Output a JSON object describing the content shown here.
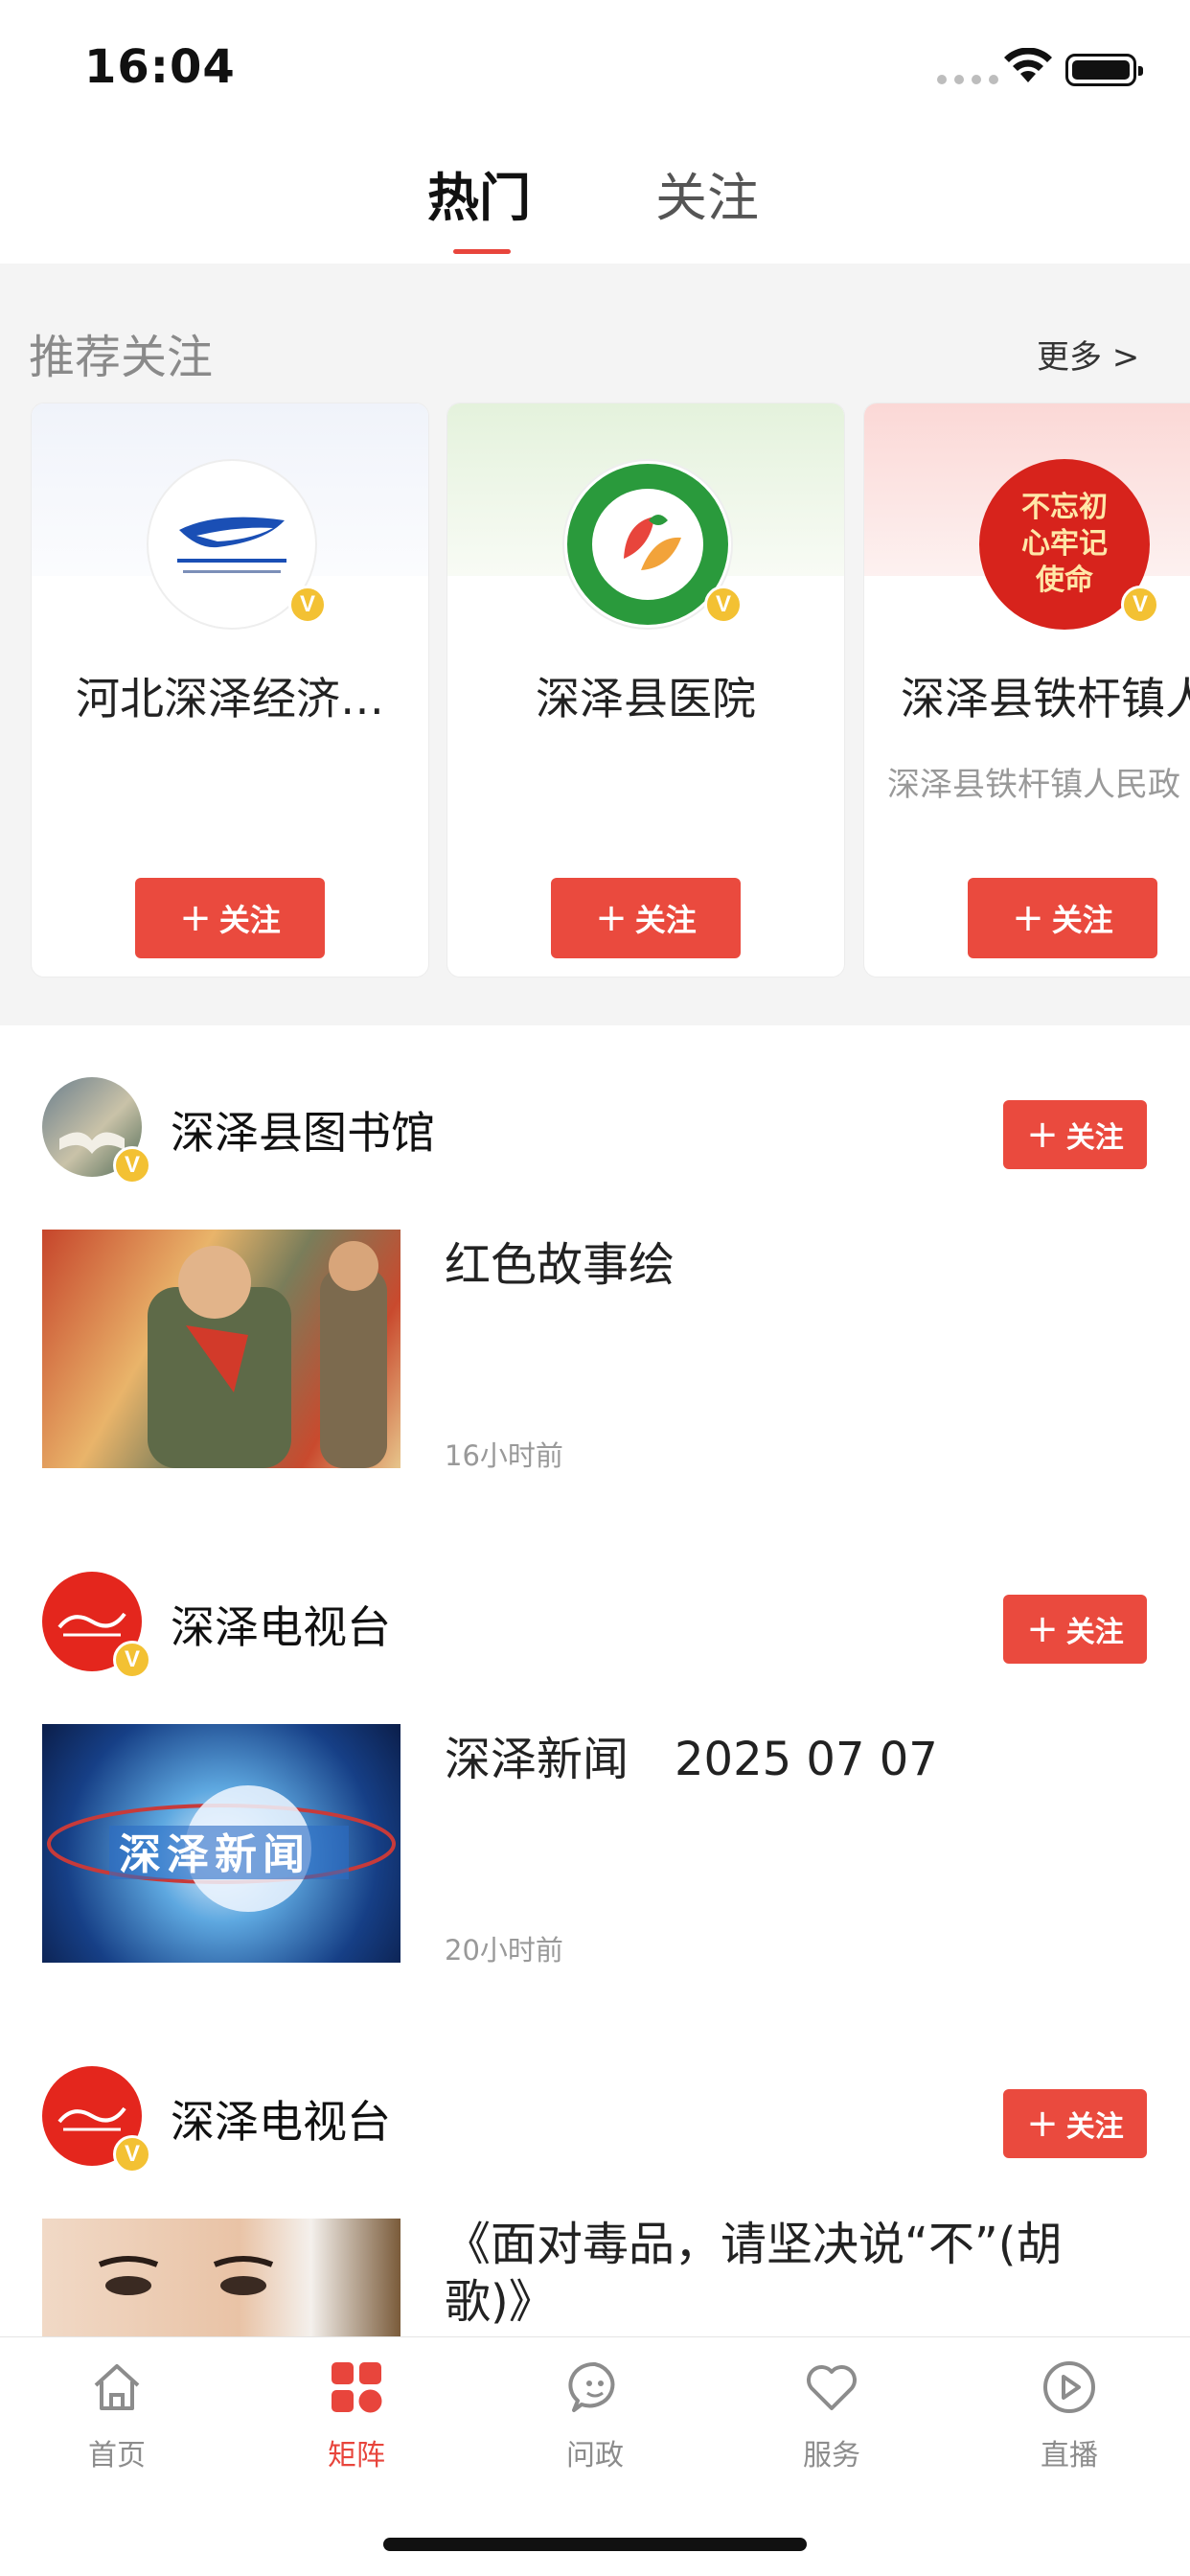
{
  "status_bar": {
    "time": "16:04"
  },
  "top_tabs": [
    {
      "label": "热门",
      "active": true
    },
    {
      "label": "关注",
      "active": false
    }
  ],
  "recommend": {
    "title": "推荐关注",
    "more": "更多 >",
    "cards": [
      {
        "name": "河北深泽经济…",
        "subtitle": "",
        "follow": "关注"
      },
      {
        "name": "深泽县医院",
        "subtitle": "",
        "follow": "关注"
      },
      {
        "name": "深泽县铁杆镇人民政府",
        "subtitle": "深泽县铁杆镇人民政",
        "follow": "关注",
        "avatar_text": "不忘初心牢记使命"
      }
    ]
  },
  "feed": [
    {
      "account": "深泽县图书馆",
      "follow": "关注",
      "title": "红色故事绘",
      "time": "16小时前"
    },
    {
      "account": "深泽电视台",
      "follow": "关注",
      "title": "深泽新闻　2025 07 07",
      "time": "20小时前",
      "thumb_text": "深泽新闻"
    },
    {
      "account": "深泽电视台",
      "follow": "关注",
      "title": "《面对毒品，请坚决说“不”(胡歌)》",
      "time": ""
    }
  ],
  "bottom_nav": [
    {
      "label": "首页",
      "icon": "home-icon",
      "active": false
    },
    {
      "label": "矩阵",
      "icon": "matrix-icon",
      "active": true
    },
    {
      "label": "问政",
      "icon": "chat-icon",
      "active": false
    },
    {
      "label": "服务",
      "icon": "heart-icon",
      "active": false
    },
    {
      "label": "直播",
      "icon": "play-icon",
      "active": false
    }
  ],
  "colors": {
    "accent": "#e8453c",
    "badge": "#f3c133"
  }
}
